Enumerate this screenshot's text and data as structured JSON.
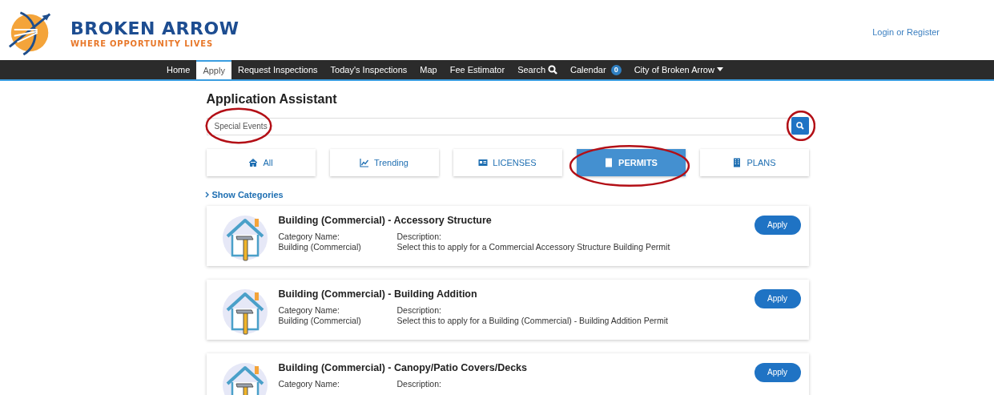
{
  "header": {
    "logo_title": "BROKEN ARROW",
    "logo_tagline": "WHERE OPPORTUNITY LIVES",
    "login_link": "Login or Register"
  },
  "nav": {
    "items": [
      {
        "label": "Home",
        "selected": false,
        "kind": "link"
      },
      {
        "label": "Apply",
        "selected": true,
        "kind": "link"
      },
      {
        "label": "Request Inspections",
        "selected": false,
        "kind": "link"
      },
      {
        "label": "Today's Inspections",
        "selected": false,
        "kind": "link"
      },
      {
        "label": "Map",
        "selected": false,
        "kind": "link"
      },
      {
        "label": "Fee Estimator",
        "selected": false,
        "kind": "link"
      },
      {
        "label": "Search",
        "selected": false,
        "kind": "search"
      },
      {
        "label": "Calendar",
        "selected": false,
        "kind": "calendar",
        "badge": "0"
      },
      {
        "label": "City of Broken Arrow",
        "selected": false,
        "kind": "dropdown"
      }
    ]
  },
  "page_title": "Application Assistant",
  "search": {
    "value": "Special Events",
    "circled": true,
    "button_circled": true
  },
  "tabs": [
    {
      "label": "All",
      "kind": "home",
      "selected": false,
      "circled": false
    },
    {
      "label": "Trending",
      "kind": "trending",
      "selected": false,
      "circled": false
    },
    {
      "label": "LICENSES",
      "kind": "licenses",
      "selected": false,
      "circled": false
    },
    {
      "label": "PERMITS",
      "kind": "permits",
      "selected": true,
      "circled": true
    },
    {
      "label": "PLANS",
      "kind": "plans",
      "selected": false,
      "circled": false
    }
  ],
  "show_categories": "Show Categories",
  "results": [
    {
      "title": "Building (Commercial) - Accessory Structure",
      "category_label": "Category Name:",
      "category": "Building (Commercial)",
      "description_label": "Description:",
      "description": "Select this to apply for a Commercial Accessory Structure Building Permit",
      "button": "Apply"
    },
    {
      "title": "Building (Commercial) - Building Addition",
      "category_label": "Category Name:",
      "category": "Building (Commercial)",
      "description_label": "Description:",
      "description": "Select this to apply for a Building (Commercial) - Building Addition Permit",
      "button": "Apply"
    },
    {
      "title": "Building (Commercial) - Canopy/Patio Covers/Decks",
      "category_label": "Category Name:",
      "description_label": "Description:",
      "button": "Apply"
    }
  ]
}
